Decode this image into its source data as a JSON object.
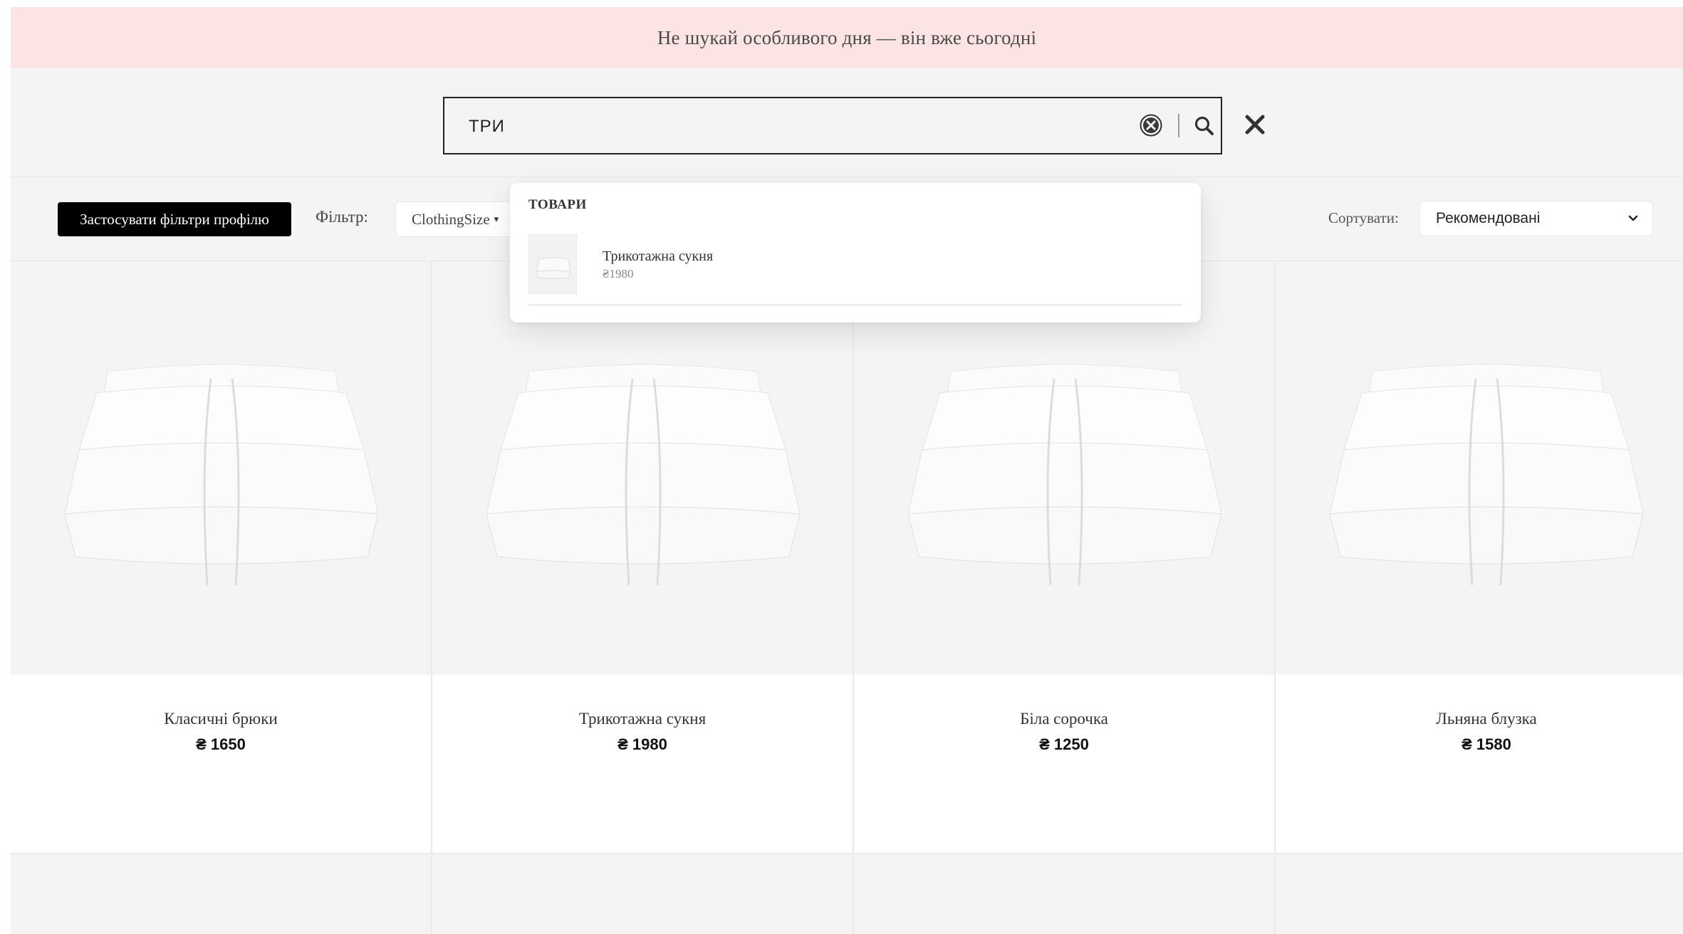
{
  "promo": {
    "text": "Не шукай особливого дня — він вже сьогодні"
  },
  "search": {
    "value": "ТРИ"
  },
  "filters": {
    "apply_profile_label": "Застосувати фільтри профілю",
    "filter_label": "Фільтр:",
    "size_dropdown_label": "ClothingSize",
    "sort_label": "Сортувати:",
    "sort_value": "Рекомендовані"
  },
  "suggestions": {
    "heading": "ТОВАРИ",
    "items": [
      {
        "name": "Трикотажна сукня",
        "price": "₴1980"
      }
    ]
  },
  "products": [
    {
      "name": "Класичні брюки",
      "price": "₴ 1650"
    },
    {
      "name": "Трикотажна сукня",
      "price": "₴ 1980"
    },
    {
      "name": "Біла сорочка",
      "price": "₴ 1250"
    },
    {
      "name": "Льняна блузка",
      "price": "₴ 1580"
    }
  ],
  "icons": {
    "clear": "circle-x-icon",
    "search": "magnifier-icon",
    "close": "close-icon",
    "dropdown": "chevron-down-icon"
  },
  "colors": {
    "promo_bg": "#fce4e4",
    "page_bg": "#f4f4f4",
    "button_bg": "#000000"
  }
}
